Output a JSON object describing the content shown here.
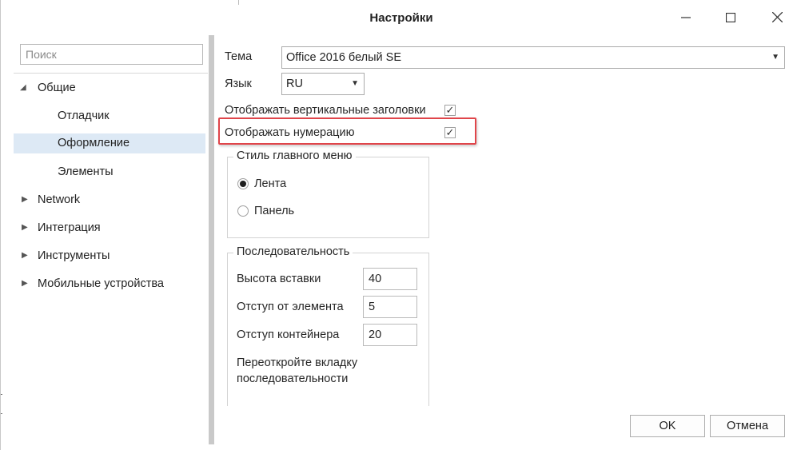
{
  "window": {
    "title": "Настройки",
    "controls": {
      "minimize_icon": "minimize-icon",
      "maximize_icon": "maximize-icon",
      "close_icon": "close-icon"
    }
  },
  "sidebar": {
    "search_placeholder": "Поиск",
    "items": [
      {
        "label": "Общие",
        "expanded": true,
        "level": 0
      },
      {
        "label": "Отладчик",
        "level": 1
      },
      {
        "label": "Оформление",
        "level": 1,
        "selected": true
      },
      {
        "label": "Элементы",
        "level": 1
      },
      {
        "label": "Network",
        "expanded": false,
        "level": 0
      },
      {
        "label": "Интеграция",
        "expanded": false,
        "level": 0
      },
      {
        "label": "Инструменты",
        "expanded": false,
        "level": 0
      },
      {
        "label": "Мобильные устройства",
        "expanded": false,
        "level": 0
      }
    ]
  },
  "settings": {
    "theme_label": "Тема",
    "theme_value": "Office 2016 белый SE",
    "language_label": "Язык",
    "language_value": "RU",
    "vertical_headers_label": "Отображать вертикальные заголовки",
    "vertical_headers_checked": true,
    "numbering_label": "Отображать нумерацию",
    "numbering_checked": true,
    "menu_style": {
      "title": "Стиль главного меню",
      "options": [
        {
          "label": "Лента",
          "selected": true
        },
        {
          "label": "Панель",
          "selected": false
        }
      ]
    },
    "sequence": {
      "title": "Последовательность",
      "insert_height_label": "Высота вставки",
      "insert_height_value": "40",
      "element_offset_label": "Отступ от элемента",
      "element_offset_value": "5",
      "container_offset_label": "Отступ контейнера",
      "container_offset_value": "20",
      "note_line1": "Переоткройте вкладку",
      "note_line2": "последовательности"
    }
  },
  "footer": {
    "ok_label": "OK",
    "cancel_label": "Отмена"
  },
  "colors": {
    "selection_bg": "#dde9f5",
    "highlight_border": "#e0454a",
    "scrollbar": "#c9c9c9"
  }
}
